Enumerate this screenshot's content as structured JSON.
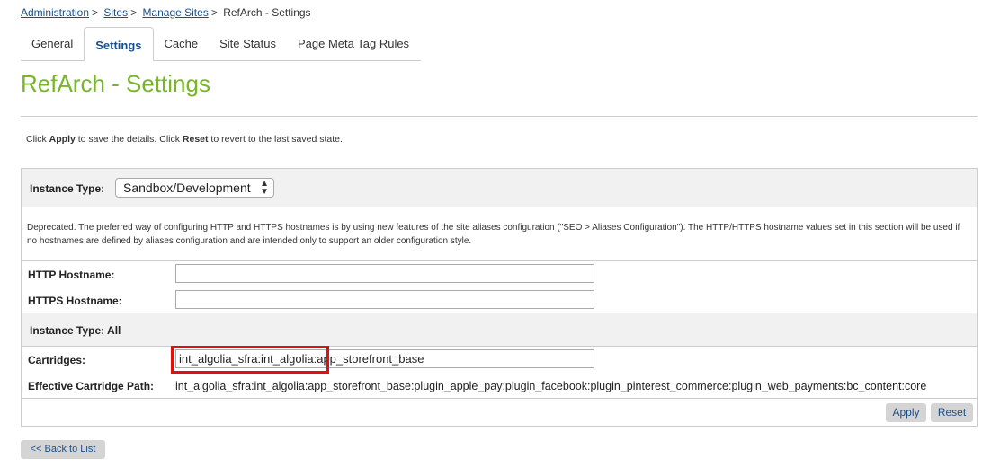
{
  "breadcrumb": {
    "items": [
      {
        "label": "Administration",
        "link": true
      },
      {
        "label": "Sites",
        "link": true
      },
      {
        "label": "Manage Sites",
        "link": true
      },
      {
        "label": "RefArch - Settings",
        "link": false
      }
    ],
    "separator": ">"
  },
  "tabs": [
    {
      "label": "General",
      "active": false
    },
    {
      "label": "Settings",
      "active": true
    },
    {
      "label": "Cache",
      "active": false
    },
    {
      "label": "Site Status",
      "active": false
    },
    {
      "label": "Page Meta Tag Rules",
      "active": false
    }
  ],
  "page": {
    "title": "RefArch - Settings",
    "help_parts": {
      "p1": "Click ",
      "apply": "Apply",
      "p2": " to save the details. Click ",
      "reset": "Reset",
      "p3": " to revert to the last saved state."
    }
  },
  "form": {
    "instance_type_label": "Instance Type:",
    "instance_type_value": "Sandbox/Development",
    "deprecated_note": "Deprecated. The preferred way of configuring HTTP and HTTPS hostnames is by using new features of the site aliases configuration (\"SEO > Aliases Configuration\"). The HTTP/HTTPS hostname values set in this section will be used if no hostnames are defined by aliases configuration and are intended only to support an older configuration style.",
    "http_hostname_label": "HTTP Hostname:",
    "http_hostname_value": "",
    "https_hostname_label": "HTTPS Hostname:",
    "https_hostname_value": "",
    "instance_type_all_label": "Instance Type:  All",
    "cartridges_label": "Cartridges:",
    "cartridges_value": "int_algolia_sfra:int_algolia:app_storefront_base",
    "effective_path_label": "Effective Cartridge Path:",
    "effective_path_value": "int_algolia_sfra:int_algolia:app_storefront_base:plugin_apple_pay:plugin_facebook:plugin_pinterest_commerce:plugin_web_payments:bc_content:core",
    "apply_label": "Apply",
    "reset_label": "Reset"
  },
  "back_label": "<< Back to List",
  "colors": {
    "title_green": "#77b52a",
    "link_blue": "#1a4e8a",
    "highlight_red": "#e01010"
  }
}
